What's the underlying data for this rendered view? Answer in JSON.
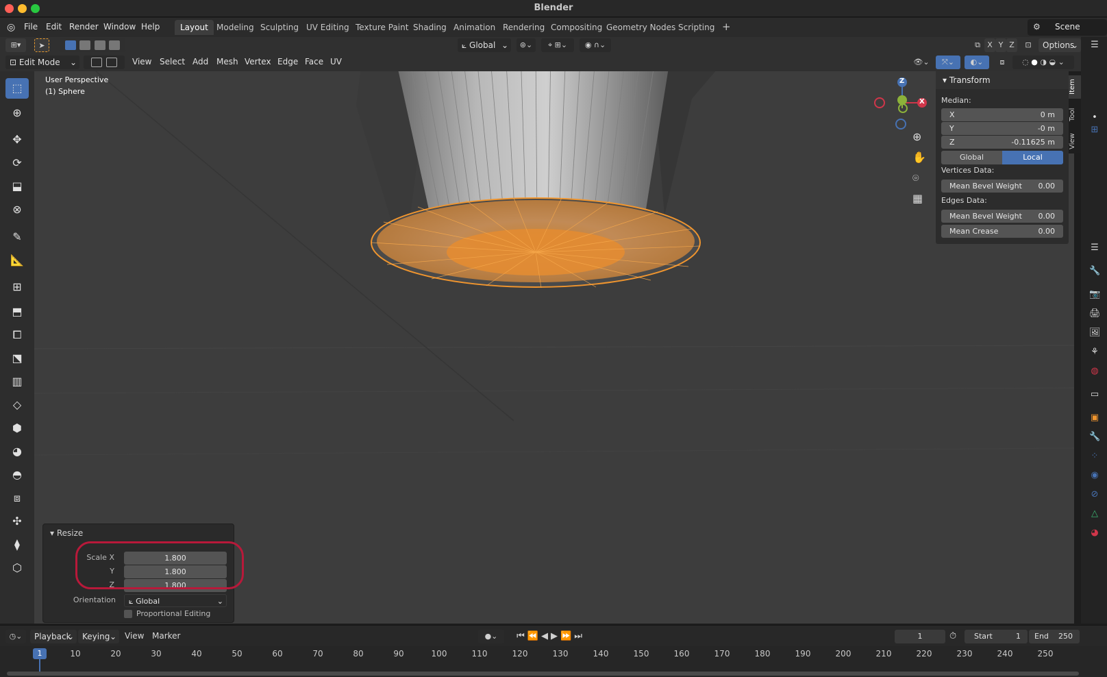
{
  "app": {
    "title": "Blender"
  },
  "menu": {
    "items": [
      "File",
      "Edit",
      "Render",
      "Window",
      "Help"
    ],
    "workspaces": [
      "Layout",
      "Modeling",
      "Sculpting",
      "UV Editing",
      "Texture Paint",
      "Shading",
      "Animation",
      "Rendering",
      "Compositing",
      "Geometry Nodes",
      "Scripting"
    ],
    "active_workspace": "Layout",
    "add_tab": "+",
    "scene": "Scene"
  },
  "header": {
    "orientation": "Global",
    "axes": [
      "X",
      "Y",
      "Z"
    ],
    "options": "Options"
  },
  "viewport_header": {
    "mode": "Edit Mode",
    "menus": [
      "View",
      "Select",
      "Add",
      "Mesh",
      "Vertex",
      "Edge",
      "Face",
      "UV"
    ]
  },
  "viewport": {
    "perspective": "User Perspective",
    "object": "(1) Sphere",
    "gizmo": {
      "z": "Z",
      "x": "X"
    }
  },
  "npanel": {
    "title": "Transform",
    "median_label": "Median:",
    "median": [
      {
        "label": "X",
        "value": "0 m"
      },
      {
        "label": "Y",
        "value": "-0 m"
      },
      {
        "label": "Z",
        "value": "-0.11625 m"
      }
    ],
    "space_options": [
      "Global",
      "Local"
    ],
    "active_space": "Local",
    "vertices_data_label": "Vertices Data:",
    "vertices_fields": [
      {
        "label": "Mean Bevel Weight",
        "value": "0.00"
      }
    ],
    "edges_data_label": "Edges Data:",
    "edges_fields": [
      {
        "label": "Mean Bevel Weight",
        "value": "0.00"
      },
      {
        "label": "Mean Crease",
        "value": "0.00"
      }
    ],
    "tabs": [
      "Item",
      "Tool",
      "View"
    ]
  },
  "redo_panel": {
    "title": "Resize",
    "scale_label": "Scale X",
    "y_label": "Y",
    "z_label": "Z",
    "scale": [
      "1.800",
      "1.800",
      "1.800"
    ],
    "orientation_label": "Orientation",
    "orientation": "Global",
    "proportional": "Proportional Editing"
  },
  "timeline": {
    "menus": [
      "Playback",
      "Keying",
      "View",
      "Marker"
    ],
    "current_frame": "1",
    "start_label": "Start",
    "start": "1",
    "end_label": "End",
    "end": "250",
    "ticks": [
      "10",
      "20",
      "30",
      "40",
      "50",
      "60",
      "70",
      "80",
      "90",
      "100",
      "110",
      "120",
      "130",
      "140",
      "150",
      "160",
      "170",
      "180",
      "190",
      "200",
      "210",
      "220",
      "230",
      "240",
      "250"
    ]
  },
  "colors": {
    "accent": "#4772b3",
    "selection": "#f0952e",
    "highlight": "#b8193a"
  }
}
